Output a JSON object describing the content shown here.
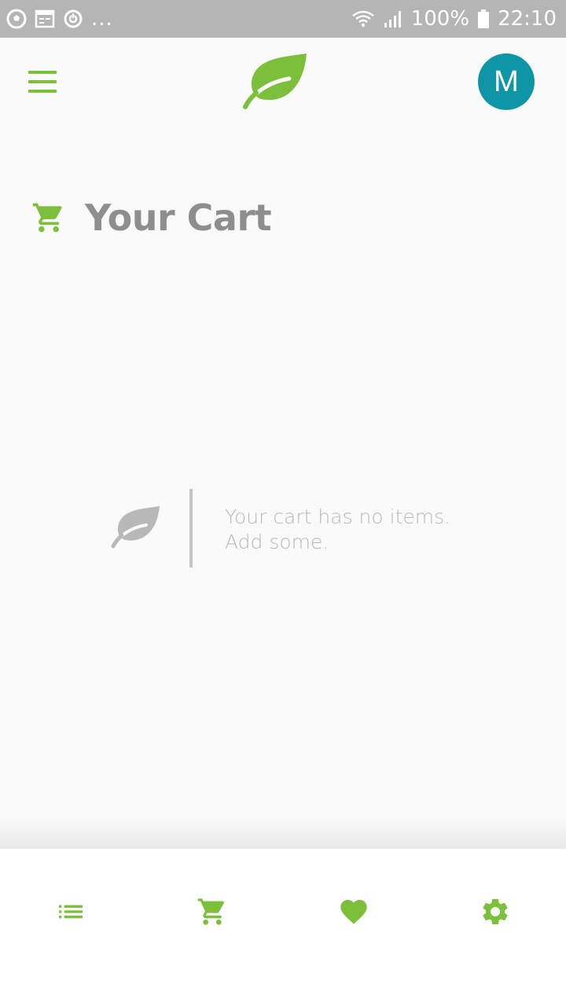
{
  "status_bar": {
    "battery_percent": "100%",
    "time": "22:10",
    "more_indicator": "...",
    "icons": [
      "soccer-ball-icon",
      "calendar-icon",
      "sync-icon",
      "wifi-icon",
      "signal-icon",
      "battery-icon"
    ]
  },
  "app_bar": {
    "menu_icon": "hamburger-menu-icon",
    "logo_icon": "leaf-logo-icon",
    "avatar_letter": "M"
  },
  "page": {
    "title": "Your Cart",
    "title_icon": "shopping-cart-icon"
  },
  "empty_state": {
    "icon": "leaf-icon",
    "line1": "Your cart has no items.",
    "line2": "Add some."
  },
  "bottom_nav": {
    "tabs": [
      {
        "icon": "list-icon"
      },
      {
        "icon": "shopping-cart-icon"
      },
      {
        "icon": "heart-icon"
      },
      {
        "icon": "gear-icon"
      }
    ]
  },
  "colors": {
    "accent_green": "#7bbf3a",
    "avatar_teal": "#0f96a6",
    "status_bar": "#b5b5b5",
    "muted_text": "#b8b8b8",
    "title_gray": "#8e8e8e",
    "background": "#fafafa"
  }
}
